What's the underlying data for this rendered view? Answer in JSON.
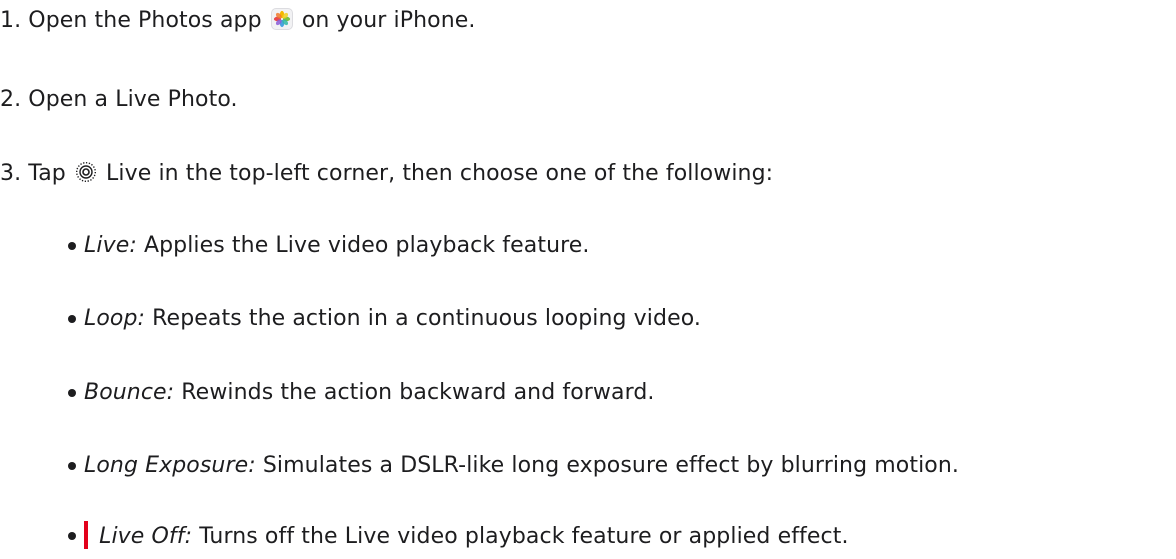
{
  "steps": [
    {
      "num": "1.",
      "before": "Open the Photos app",
      "after": "on your iPhone.",
      "icon": "photos-app-icon"
    },
    {
      "num": "2.",
      "text": "Open a Live Photo."
    },
    {
      "num": "3.",
      "before": "Tap",
      "after": "Live in the top-left corner, then choose one of the following:",
      "icon": "live-photo-icon"
    }
  ],
  "options": [
    {
      "term": "Live:",
      "desc": "Applies the Live video playback feature."
    },
    {
      "term": "Loop:",
      "desc": "Repeats the action in a continuous looping video."
    },
    {
      "term": "Bounce:",
      "desc": "Rewinds the action backward and forward."
    },
    {
      "term": "Long Exposure:",
      "desc": "Simulates a DSLR-like long exposure effect by blurring motion."
    },
    {
      "term": "Live Off:",
      "desc": "Turns off the Live video playback feature or applied effect."
    }
  ],
  "colors": {
    "text": "#1d1d1f",
    "cursor": "#e3001b",
    "background": "#ffffff"
  }
}
